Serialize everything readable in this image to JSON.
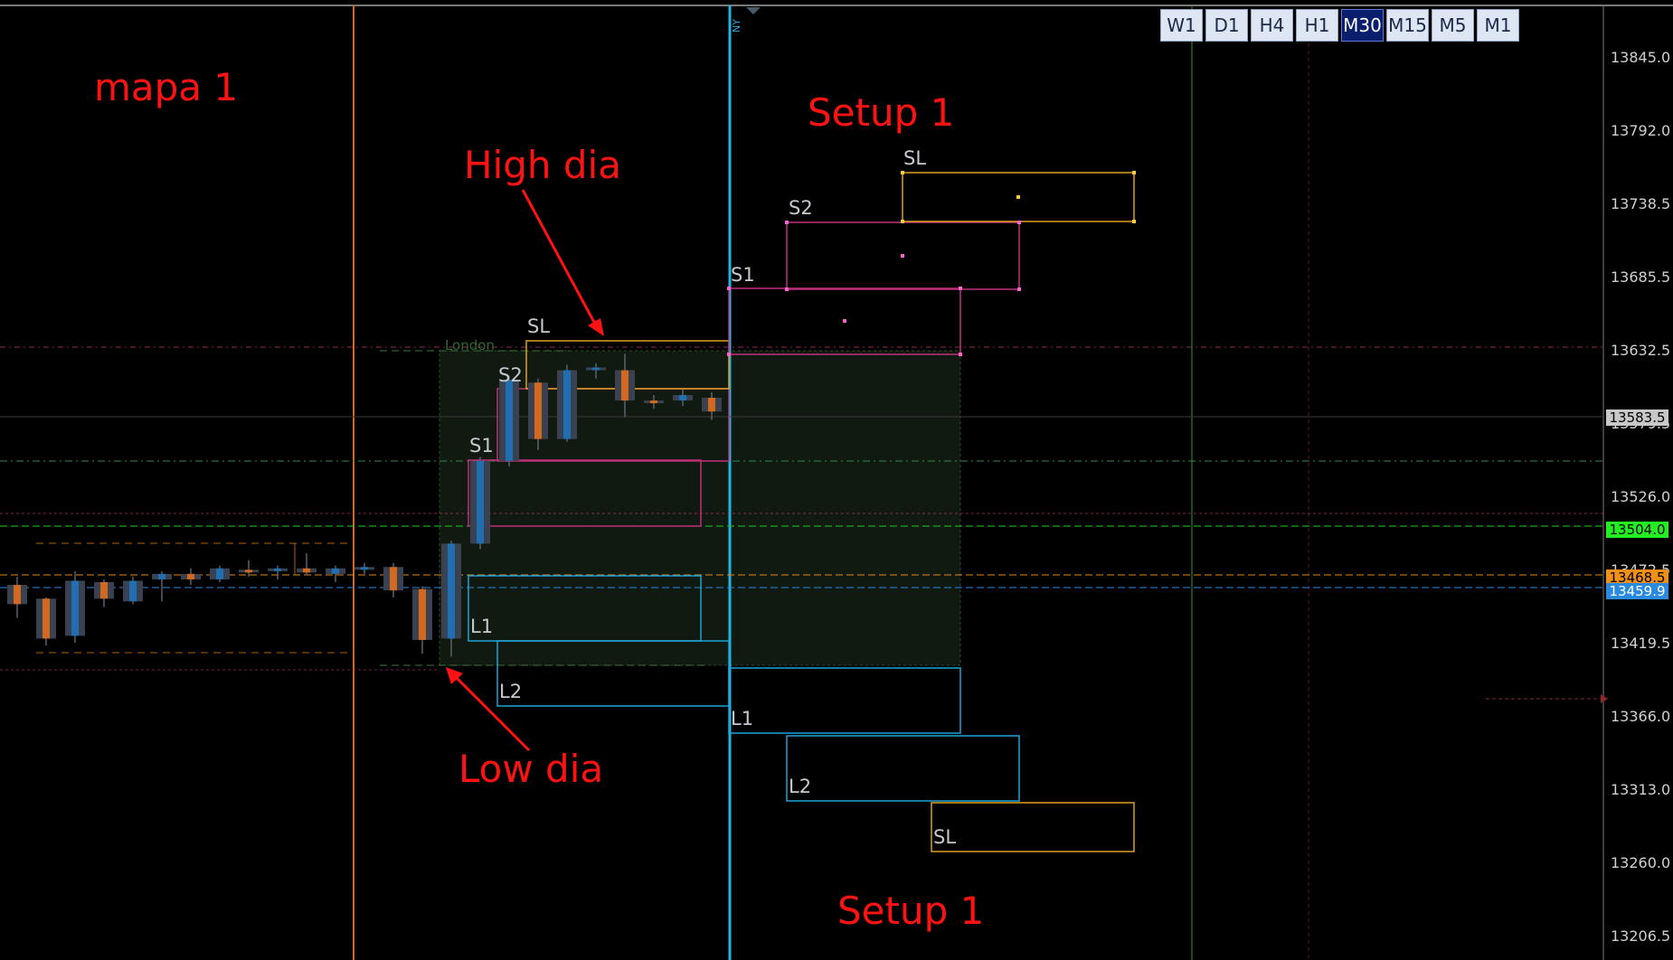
{
  "timeframes": [
    {
      "label": "W1",
      "active": false
    },
    {
      "label": "D1",
      "active": false
    },
    {
      "label": "H4",
      "active": false
    },
    {
      "label": "H1",
      "active": false
    },
    {
      "label": "M30",
      "active": true
    },
    {
      "label": "M15",
      "active": false
    },
    {
      "label": "M5",
      "active": false
    },
    {
      "label": "M1",
      "active": false
    }
  ],
  "annotations": {
    "mapa": "mapa 1",
    "setup_top": "Setup 1",
    "setup_bottom": "Setup 1",
    "high_dia": "High dia",
    "low_dia": "Low dia"
  },
  "price_axis": {
    "labels": [
      "13845.0",
      "13792.0",
      "13738.5",
      "13685.5",
      "13632.5",
      "13579.5",
      "13526.0",
      "13472.5",
      "13419.5",
      "13366.0",
      "13313.0",
      "13260.0",
      "13206.5"
    ]
  },
  "price_tags": {
    "current": "13583.5",
    "green": "13504.0",
    "orange": "13468.5",
    "blue": "13459.9"
  },
  "session_labels": {
    "london": "London",
    "ny": "NY"
  },
  "box_labels": {
    "asia_s1": "S1",
    "asia_s2": "S2",
    "asia_sl": "SL",
    "asia_l1": "L1",
    "asia_l2": "L2",
    "ny_s1": "S1",
    "ny_s2": "S2",
    "ny_sl": "SL",
    "ny_l1": "L1",
    "ny_l2": "L2",
    "ny_sl_low": "SL"
  },
  "colors": {
    "background": "#000000",
    "bull_body": "#1f6fb2",
    "bear_body": "#d2691e",
    "candle_shadow": "#3a4150",
    "short_box": "#c0307a",
    "long_box": "#1fa3d6",
    "sl_box": "#e0a020",
    "annotation_text": "#ff1212"
  },
  "chart_data": {
    "type": "candlestick",
    "symbol_timeframe": "M30",
    "price_range": [
      13206.5,
      13845.0
    ],
    "candles": [
      {
        "o": 13462,
        "h": 13468,
        "l": 13438,
        "c": 13448,
        "dir": "bear"
      },
      {
        "o": 13452,
        "h": 13453,
        "l": 13418,
        "c": 13423,
        "dir": "bear"
      },
      {
        "o": 13425,
        "h": 13472,
        "l": 13420,
        "c": 13465,
        "dir": "bull"
      },
      {
        "o": 13464,
        "h": 13466,
        "l": 13446,
        "c": 13452,
        "dir": "bear"
      },
      {
        "o": 13450,
        "h": 13468,
        "l": 13448,
        "c": 13465,
        "dir": "bull"
      },
      {
        "o": 13466,
        "h": 13472,
        "l": 13450,
        "c": 13470,
        "dir": "bull"
      },
      {
        "o": 13470,
        "h": 13474,
        "l": 13462,
        "c": 13466,
        "dir": "bear"
      },
      {
        "o": 13466,
        "h": 13476,
        "l": 13464,
        "c": 13474,
        "dir": "bull"
      },
      {
        "o": 13473,
        "h": 13480,
        "l": 13468,
        "c": 13472,
        "dir": "bear"
      },
      {
        "o": 13472,
        "h": 13476,
        "l": 13466,
        "c": 13474,
        "dir": "bull"
      },
      {
        "o": 13474,
        "h": 13485,
        "l": 13469,
        "c": 13471,
        "dir": "bear"
      },
      {
        "o": 13470,
        "h": 13476,
        "l": 13464,
        "c": 13474,
        "dir": "bull"
      },
      {
        "o": 13473,
        "h": 13478,
        "l": 13470,
        "c": 13475,
        "dir": "bull"
      },
      {
        "o": 13475,
        "h": 13478,
        "l": 13453,
        "c": 13458,
        "dir": "bear"
      },
      {
        "o": 13459,
        "h": 13461,
        "l": 13412,
        "c": 13422,
        "dir": "bear"
      },
      {
        "o": 13423,
        "h": 13494,
        "l": 13410,
        "c": 13492,
        "dir": "bull"
      },
      {
        "o": 13492,
        "h": 13555,
        "l": 13488,
        "c": 13552,
        "dir": "bull"
      },
      {
        "o": 13552,
        "h": 13614,
        "l": 13548,
        "c": 13611,
        "dir": "bull"
      },
      {
        "o": 13609,
        "h": 13612,
        "l": 13560,
        "c": 13568,
        "dir": "bear"
      },
      {
        "o": 13568,
        "h": 13622,
        "l": 13566,
        "c": 13618,
        "dir": "bull"
      },
      {
        "o": 13619,
        "h": 13623,
        "l": 13612,
        "c": 13620,
        "dir": "bull"
      },
      {
        "o": 13618,
        "h": 13630,
        "l": 13584,
        "c": 13596,
        "dir": "bear"
      },
      {
        "o": 13596,
        "h": 13600,
        "l": 13590,
        "c": 13595,
        "dir": "bear"
      },
      {
        "o": 13596,
        "h": 13604,
        "l": 13592,
        "c": 13600,
        "dir": "bull"
      },
      {
        "o": 13598,
        "h": 13602,
        "l": 13582,
        "c": 13588,
        "dir": "bear"
      }
    ]
  }
}
